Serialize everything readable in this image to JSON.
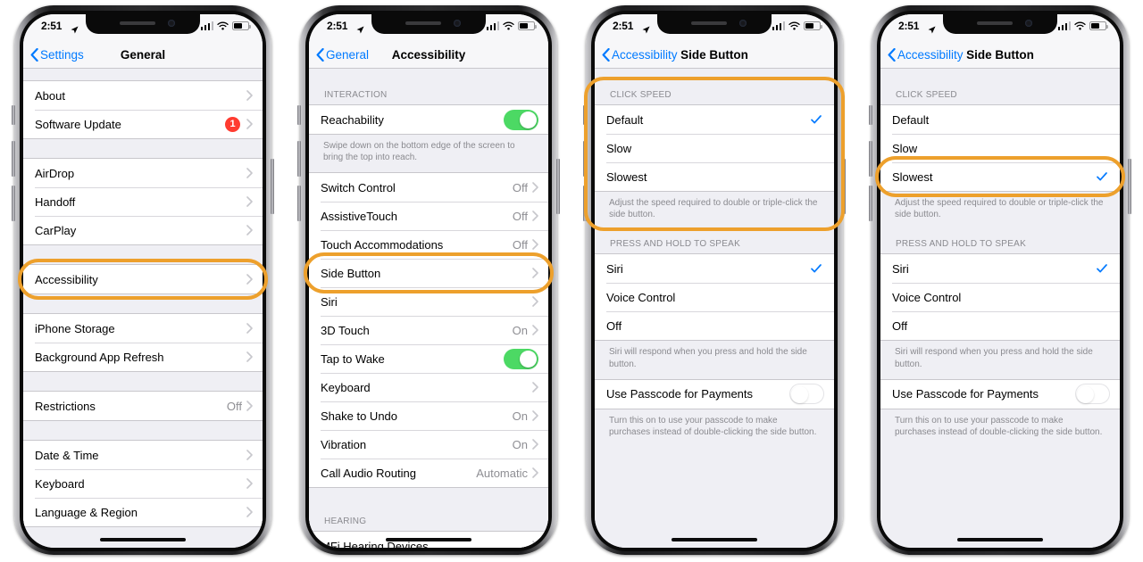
{
  "status_bar": {
    "time": "2:51",
    "location_icon": "location-arrow-icon",
    "signal_icon": "cellular-bars-icon",
    "wifi_icon": "wifi-icon",
    "battery_icon": "battery-icon",
    "battery_level_percent": 62
  },
  "colors": {
    "highlight_orange": "#eda02c",
    "ios_blue": "#007aff",
    "toggle_green": "#4cd964",
    "badge_red": "#ff3b30",
    "group_bg": "#ffffff",
    "page_bg": "#efeff4",
    "secondary_text": "#8e8e93"
  },
  "phones": [
    {
      "id": "general-settings",
      "nav": {
        "back_label": "Settings",
        "title": "General"
      },
      "sections": [
        {
          "header": "",
          "rows": [
            {
              "label": "About",
              "value": "",
              "accessory": "chevron"
            },
            {
              "label": "Software Update",
              "value": "",
              "badge": "1",
              "accessory": "chevron"
            }
          ],
          "footer": ""
        },
        {
          "header": "",
          "rows": [
            {
              "label": "AirDrop",
              "value": "",
              "accessory": "chevron"
            },
            {
              "label": "Handoff",
              "value": "",
              "accessory": "chevron"
            },
            {
              "label": "CarPlay",
              "value": "",
              "accessory": "chevron"
            }
          ],
          "footer": ""
        },
        {
          "header": "",
          "rows": [
            {
              "label": "Accessibility",
              "value": "",
              "accessory": "chevron",
              "highlighted": true
            }
          ],
          "footer": ""
        },
        {
          "header": "",
          "rows": [
            {
              "label": "iPhone Storage",
              "value": "",
              "accessory": "chevron"
            },
            {
              "label": "Background App Refresh",
              "value": "",
              "accessory": "chevron"
            }
          ],
          "footer": ""
        },
        {
          "header": "",
          "rows": [
            {
              "label": "Restrictions",
              "value": "Off",
              "accessory": "chevron"
            }
          ],
          "footer": ""
        },
        {
          "header": "",
          "rows": [
            {
              "label": "Date & Time",
              "value": "",
              "accessory": "chevron"
            },
            {
              "label": "Keyboard",
              "value": "",
              "accessory": "chevron"
            },
            {
              "label": "Language & Region",
              "value": "",
              "accessory": "chevron"
            }
          ],
          "footer": ""
        }
      ]
    },
    {
      "id": "accessibility",
      "nav": {
        "back_label": "General",
        "title": "Accessibility"
      },
      "sections": [
        {
          "header": "INTERACTION",
          "rows": [
            {
              "label": "Reachability",
              "value": "",
              "accessory": "toggle-on"
            }
          ],
          "footer": "Swipe down on the bottom edge of the screen to bring the top into reach."
        },
        {
          "header": "",
          "rows": [
            {
              "label": "Switch Control",
              "value": "Off",
              "accessory": "chevron"
            },
            {
              "label": "AssistiveTouch",
              "value": "Off",
              "accessory": "chevron"
            },
            {
              "label": "Touch Accommodations",
              "value": "Off",
              "accessory": "chevron"
            },
            {
              "label": "Side Button",
              "value": "",
              "accessory": "chevron",
              "highlighted": true
            },
            {
              "label": "Siri",
              "value": "",
              "accessory": "chevron"
            },
            {
              "label": "3D Touch",
              "value": "On",
              "accessory": "chevron"
            },
            {
              "label": "Tap to Wake",
              "value": "",
              "accessory": "toggle-on"
            },
            {
              "label": "Keyboard",
              "value": "",
              "accessory": "chevron"
            },
            {
              "label": "Shake to Undo",
              "value": "On",
              "accessory": "chevron"
            },
            {
              "label": "Vibration",
              "value": "On",
              "accessory": "chevron"
            },
            {
              "label": "Call Audio Routing",
              "value": "Automatic",
              "accessory": "chevron"
            }
          ],
          "footer": ""
        },
        {
          "header": "HEARING",
          "rows": [
            {
              "label": "MFi Hearing Devices",
              "value": "",
              "accessory": "chevron"
            }
          ],
          "footer": ""
        }
      ]
    },
    {
      "id": "side-button-default",
      "nav": {
        "back_label": "Accessibility",
        "title": "Side Button"
      },
      "sections": [
        {
          "header": "CLICK SPEED",
          "rows": [
            {
              "label": "Default",
              "value": "",
              "accessory": "checkmark"
            },
            {
              "label": "Slow",
              "value": "",
              "accessory": "none"
            },
            {
              "label": "Slowest",
              "value": "",
              "accessory": "none"
            }
          ],
          "footer": "Adjust the speed required to double or triple-click the side button.",
          "highlighted": true
        },
        {
          "header": "PRESS AND HOLD TO SPEAK",
          "rows": [
            {
              "label": "Siri",
              "value": "",
              "accessory": "checkmark"
            },
            {
              "label": "Voice Control",
              "value": "",
              "accessory": "none"
            },
            {
              "label": "Off",
              "value": "",
              "accessory": "none"
            }
          ],
          "footer": "Siri will respond when you press and hold the side button."
        },
        {
          "header": "",
          "rows": [
            {
              "label": "Use Passcode for Payments",
              "value": "",
              "accessory": "toggle-off"
            }
          ],
          "footer": "Turn this on to use your passcode to make purchases instead of double-clicking the side button."
        }
      ]
    },
    {
      "id": "side-button-slowest",
      "nav": {
        "back_label": "Accessibility",
        "title": "Side Button"
      },
      "sections": [
        {
          "header": "CLICK SPEED",
          "rows": [
            {
              "label": "Default",
              "value": "",
              "accessory": "none"
            },
            {
              "label": "Slow",
              "value": "",
              "accessory": "none"
            },
            {
              "label": "Slowest",
              "value": "",
              "accessory": "checkmark",
              "highlighted": true
            }
          ],
          "footer": "Adjust the speed required to double or triple-click the side button."
        },
        {
          "header": "PRESS AND HOLD TO SPEAK",
          "rows": [
            {
              "label": "Siri",
              "value": "",
              "accessory": "checkmark"
            },
            {
              "label": "Voice Control",
              "value": "",
              "accessory": "none"
            },
            {
              "label": "Off",
              "value": "",
              "accessory": "none"
            }
          ],
          "footer": "Siri will respond when you press and hold the side button."
        },
        {
          "header": "",
          "rows": [
            {
              "label": "Use Passcode for Payments",
              "value": "",
              "accessory": "toggle-off"
            }
          ],
          "footer": "Turn this on to use your passcode to make purchases instead of double-clicking the side button."
        }
      ]
    }
  ]
}
